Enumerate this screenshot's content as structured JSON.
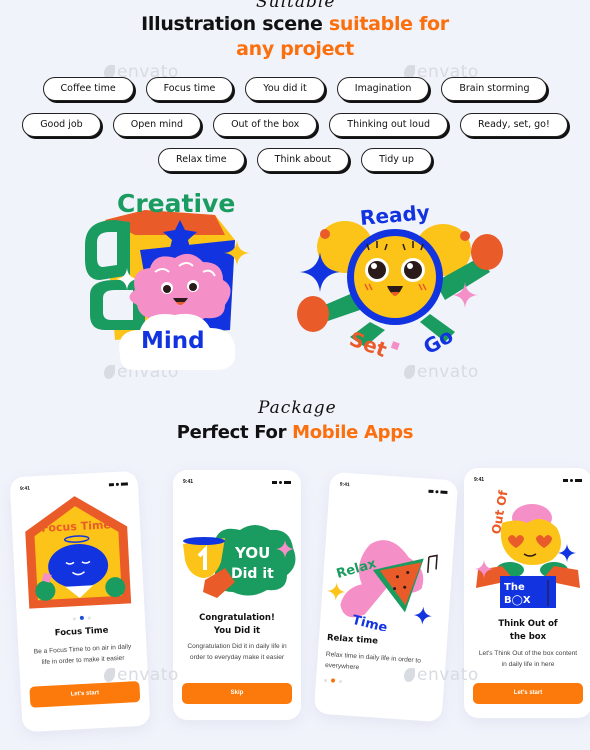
{
  "header": {
    "script_word": "Suitable",
    "title_part1": "Illustration scene ",
    "title_accent1": "suitable for",
    "title_accent2": "any project"
  },
  "tags": {
    "row1": [
      "Coffee time",
      "Focus time",
      "You did it",
      "Imagination",
      "Brain storming"
    ],
    "row2": [
      "Good job",
      "Open mind",
      "Out of the box",
      "Thinking out loud",
      "Ready, set, go!"
    ],
    "row3": [
      "Relax time",
      "Think about",
      "Tidy up"
    ]
  },
  "illustrations": {
    "creative_mind": {
      "top_text": "Creative",
      "bottom_text": "Mind"
    },
    "ready_set_go": {
      "top_text": "Ready",
      "bottom_left": "Set",
      "bottom_right": "Go"
    }
  },
  "section2": {
    "script_word": "Package",
    "title_part1": "Perfect For ",
    "title_accent": "Mobile Apps"
  },
  "watermark": "envato",
  "colors": {
    "accent": "#fb6f0d",
    "button": "#fb7a0b",
    "background": "#f1f3fb",
    "green": "#1a9b5f",
    "blue": "#1234e0",
    "yellow": "#fcc419",
    "pink": "#f58fc7",
    "red_orange": "#ea5b2a"
  },
  "phones": [
    {
      "time": "9:41",
      "art_label": "Focus Time",
      "title": "Focus Time",
      "description": "Be a Focus Time to on air in daily life in order to make it easier",
      "button": "Let's start",
      "page_index": 2,
      "dot_color": "#1d4ed8"
    },
    {
      "time": "9:41",
      "art_label": "You Did It",
      "title_line1": "Congratulation!",
      "title_line2": "You Did it",
      "description": "Congratulation Did it in daily life in order to everyday make it easier",
      "button": "Skip"
    },
    {
      "time": "9:41",
      "art_top": "Relax",
      "art_bottom": "Time",
      "title": "Relax time",
      "description": "Relax time in daily life in order to everywhere",
      "page_index": 2,
      "dot_color": "#fb6f0d"
    },
    {
      "time": "9:41",
      "art_top": "Out Of",
      "art_box1": "The",
      "art_box2": "B◯X",
      "title_line1": "Think Out of",
      "title_line2": "the box",
      "description": "Let's Think Out of the box content in daily life in here",
      "button": "Let's start"
    }
  ]
}
